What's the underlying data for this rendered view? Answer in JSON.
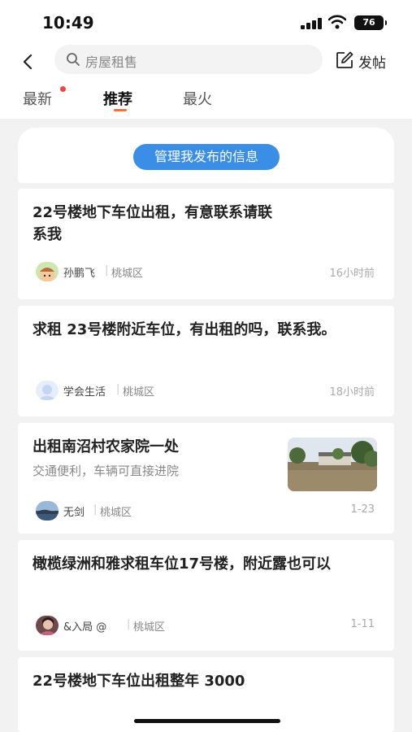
{
  "status_bar": {
    "time": "10:49",
    "battery": "76"
  },
  "header": {
    "search_placeholder": "房屋租售",
    "post_label": "发帖"
  },
  "tabs": [
    {
      "label": "最新",
      "has_dot": true
    },
    {
      "label": "推荐",
      "active": true
    },
    {
      "label": "最火"
    }
  ],
  "manage_button": "管理我发布的信息",
  "posts": [
    {
      "title": "22号楼地下车位出租，有意联系请联系我",
      "author": "孙鹏飞",
      "region": "桃城区",
      "time": "16小时前"
    },
    {
      "title": "求租 23号楼附近车位，有出租的吗，联系我。",
      "author": "学会生活",
      "region": "桃城区",
      "time": "18小时前"
    },
    {
      "title": "出租南沼村农家院一处",
      "subtitle": "交通便利，车辆可直接进院",
      "author": "无剑",
      "region": "桃城区",
      "time": "1-23"
    },
    {
      "title": "橄榄绿洲和雅求租车位17号楼，附近露也可以",
      "author": "&入局 @",
      "region": "桃城区",
      "time": "1-11"
    },
    {
      "title": "22号楼地下车位出租整年 3000"
    }
  ],
  "colors": {
    "accent": "#3a8ee6",
    "tab_indicator": "#f07040",
    "badge_dot": "#ee4444"
  }
}
